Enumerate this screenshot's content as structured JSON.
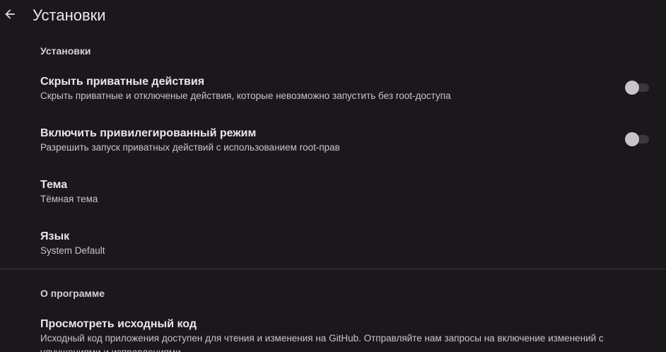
{
  "header": {
    "title": "Установки"
  },
  "sections": {
    "settings": {
      "header": "Установки",
      "hide_private": {
        "title": "Скрыть приватные действия",
        "summary": "Скрыть приватные и отключеные действия, которые невозможно запустить без root-доступа",
        "enabled": false
      },
      "privileged_mode": {
        "title": "Включить привилегированный режим",
        "summary": "Разрешить запуск приватных действий с использованием root-прав",
        "enabled": false
      },
      "theme": {
        "title": "Тема",
        "summary": "Тёмная тема"
      },
      "language": {
        "title": "Язык",
        "summary": "System Default"
      }
    },
    "about": {
      "header": "О программе",
      "source_code": {
        "title": "Просмотреть исходный код",
        "summary": "Исходный код приложения доступен для чтения и изменения на GitHub. Отправляйте нам запросы на включение изменений с улучшениями и исправлениями"
      }
    }
  },
  "colors": {
    "background": "#1b181c",
    "text_primary": "#ece6ec",
    "text_secondary": "#cbc4cb",
    "switch_thumb_off": "#c8c4c8",
    "switch_track_off": "#3b373c",
    "divider": "#3a363b"
  },
  "icons": {
    "back": "arrow-back-icon"
  }
}
